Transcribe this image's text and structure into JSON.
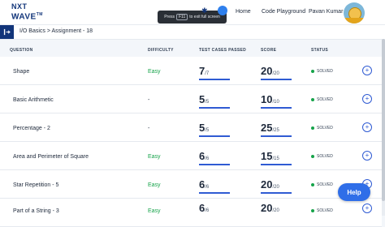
{
  "header": {
    "logo_line1": "NXT",
    "logo_line2": "WAVE",
    "logo_tm": "TM",
    "toast_prefix": "Press",
    "toast_key": "F11",
    "toast_suffix": "to exit full screen",
    "nav": [
      "Home",
      "Code Playground",
      "Pavan Kumar"
    ]
  },
  "breadcrumb": "I/O Basics > Assignment - 18",
  "columns": [
    "QUESTION",
    "DIFFICULTY",
    "TEST CASES PASSED",
    "SCORE",
    "STATUS"
  ],
  "rows": [
    {
      "question": "Shape",
      "difficulty": "Easy",
      "passed": "7",
      "total": "/7",
      "score": "20",
      "max": "/20",
      "status": "SOLVED"
    },
    {
      "question": "Basic Arithmetic",
      "difficulty": "-",
      "passed": "5",
      "total": "/5",
      "score": "10",
      "max": "/10",
      "status": "SOLVED"
    },
    {
      "question": "Percentage - 2",
      "difficulty": "-",
      "passed": "5",
      "total": "/5",
      "score": "25",
      "max": "/25",
      "status": "SOLVED"
    },
    {
      "question": "Area and Perimeter of Square",
      "difficulty": "Easy",
      "passed": "6",
      "total": "/6",
      "score": "15",
      "max": "/15",
      "status": "SOLVED"
    },
    {
      "question": "Star Repetition - 5",
      "difficulty": "Easy",
      "passed": "6",
      "total": "/6",
      "score": "20",
      "max": "/20",
      "status": "SOLVED"
    },
    {
      "question": "Part of a String - 3",
      "difficulty": "Easy",
      "passed": "6",
      "total": "/6",
      "score": "20",
      "max": "/20",
      "status": "SOLVED"
    }
  ],
  "help_label": "Help",
  "colors": {
    "brand": "#12357a",
    "accent": "#2f6ee8",
    "easy": "#16a34a",
    "solved": "#16a34a"
  }
}
